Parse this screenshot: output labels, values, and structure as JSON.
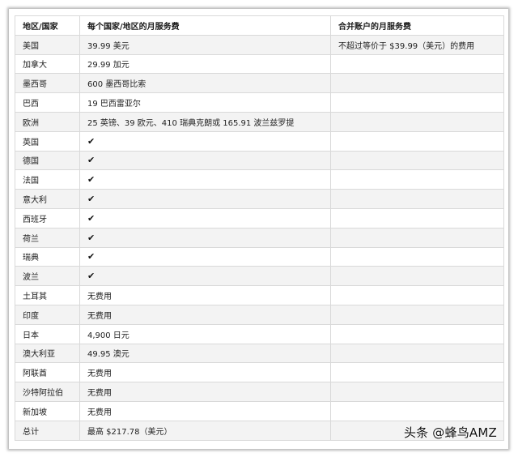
{
  "table": {
    "headers": [
      "地区/国家",
      "每个国家/地区的月服务费",
      "合并账户的月服务费"
    ],
    "rows": [
      [
        "美国",
        "39.99 美元",
        "不超过等价于 $39.99（美元）的费用"
      ],
      [
        "加拿大",
        "29.99 加元",
        ""
      ],
      [
        "墨西哥",
        "600 墨西哥比索",
        ""
      ],
      [
        "巴西",
        "19 巴西雷亚尔",
        ""
      ],
      [
        "欧洲",
        "25 英镑、39 欧元、410 瑞典克朗或 165.91 波兰兹罗提",
        ""
      ],
      [
        "英国",
        "✔",
        ""
      ],
      [
        "德国",
        "✔",
        ""
      ],
      [
        "法国",
        "✔",
        ""
      ],
      [
        "意大利",
        "✔",
        ""
      ],
      [
        "西班牙",
        "✔",
        ""
      ],
      [
        "荷兰",
        "✔",
        ""
      ],
      [
        "瑞典",
        "✔",
        ""
      ],
      [
        "波兰",
        "✔",
        ""
      ],
      [
        "土耳其",
        "无费用",
        ""
      ],
      [
        "印度",
        "无费用",
        ""
      ],
      [
        "日本",
        "4,900 日元",
        ""
      ],
      [
        "澳大利亚",
        "49.95 澳元",
        ""
      ],
      [
        "阿联酋",
        "无费用",
        ""
      ],
      [
        "沙特阿拉伯",
        "无费用",
        ""
      ],
      [
        "新加坡",
        "无费用",
        ""
      ],
      [
        "总计",
        "最高 $217.78（美元）",
        ""
      ]
    ]
  },
  "watermark": {
    "main": "头条 @蜂鸟AMZ"
  }
}
